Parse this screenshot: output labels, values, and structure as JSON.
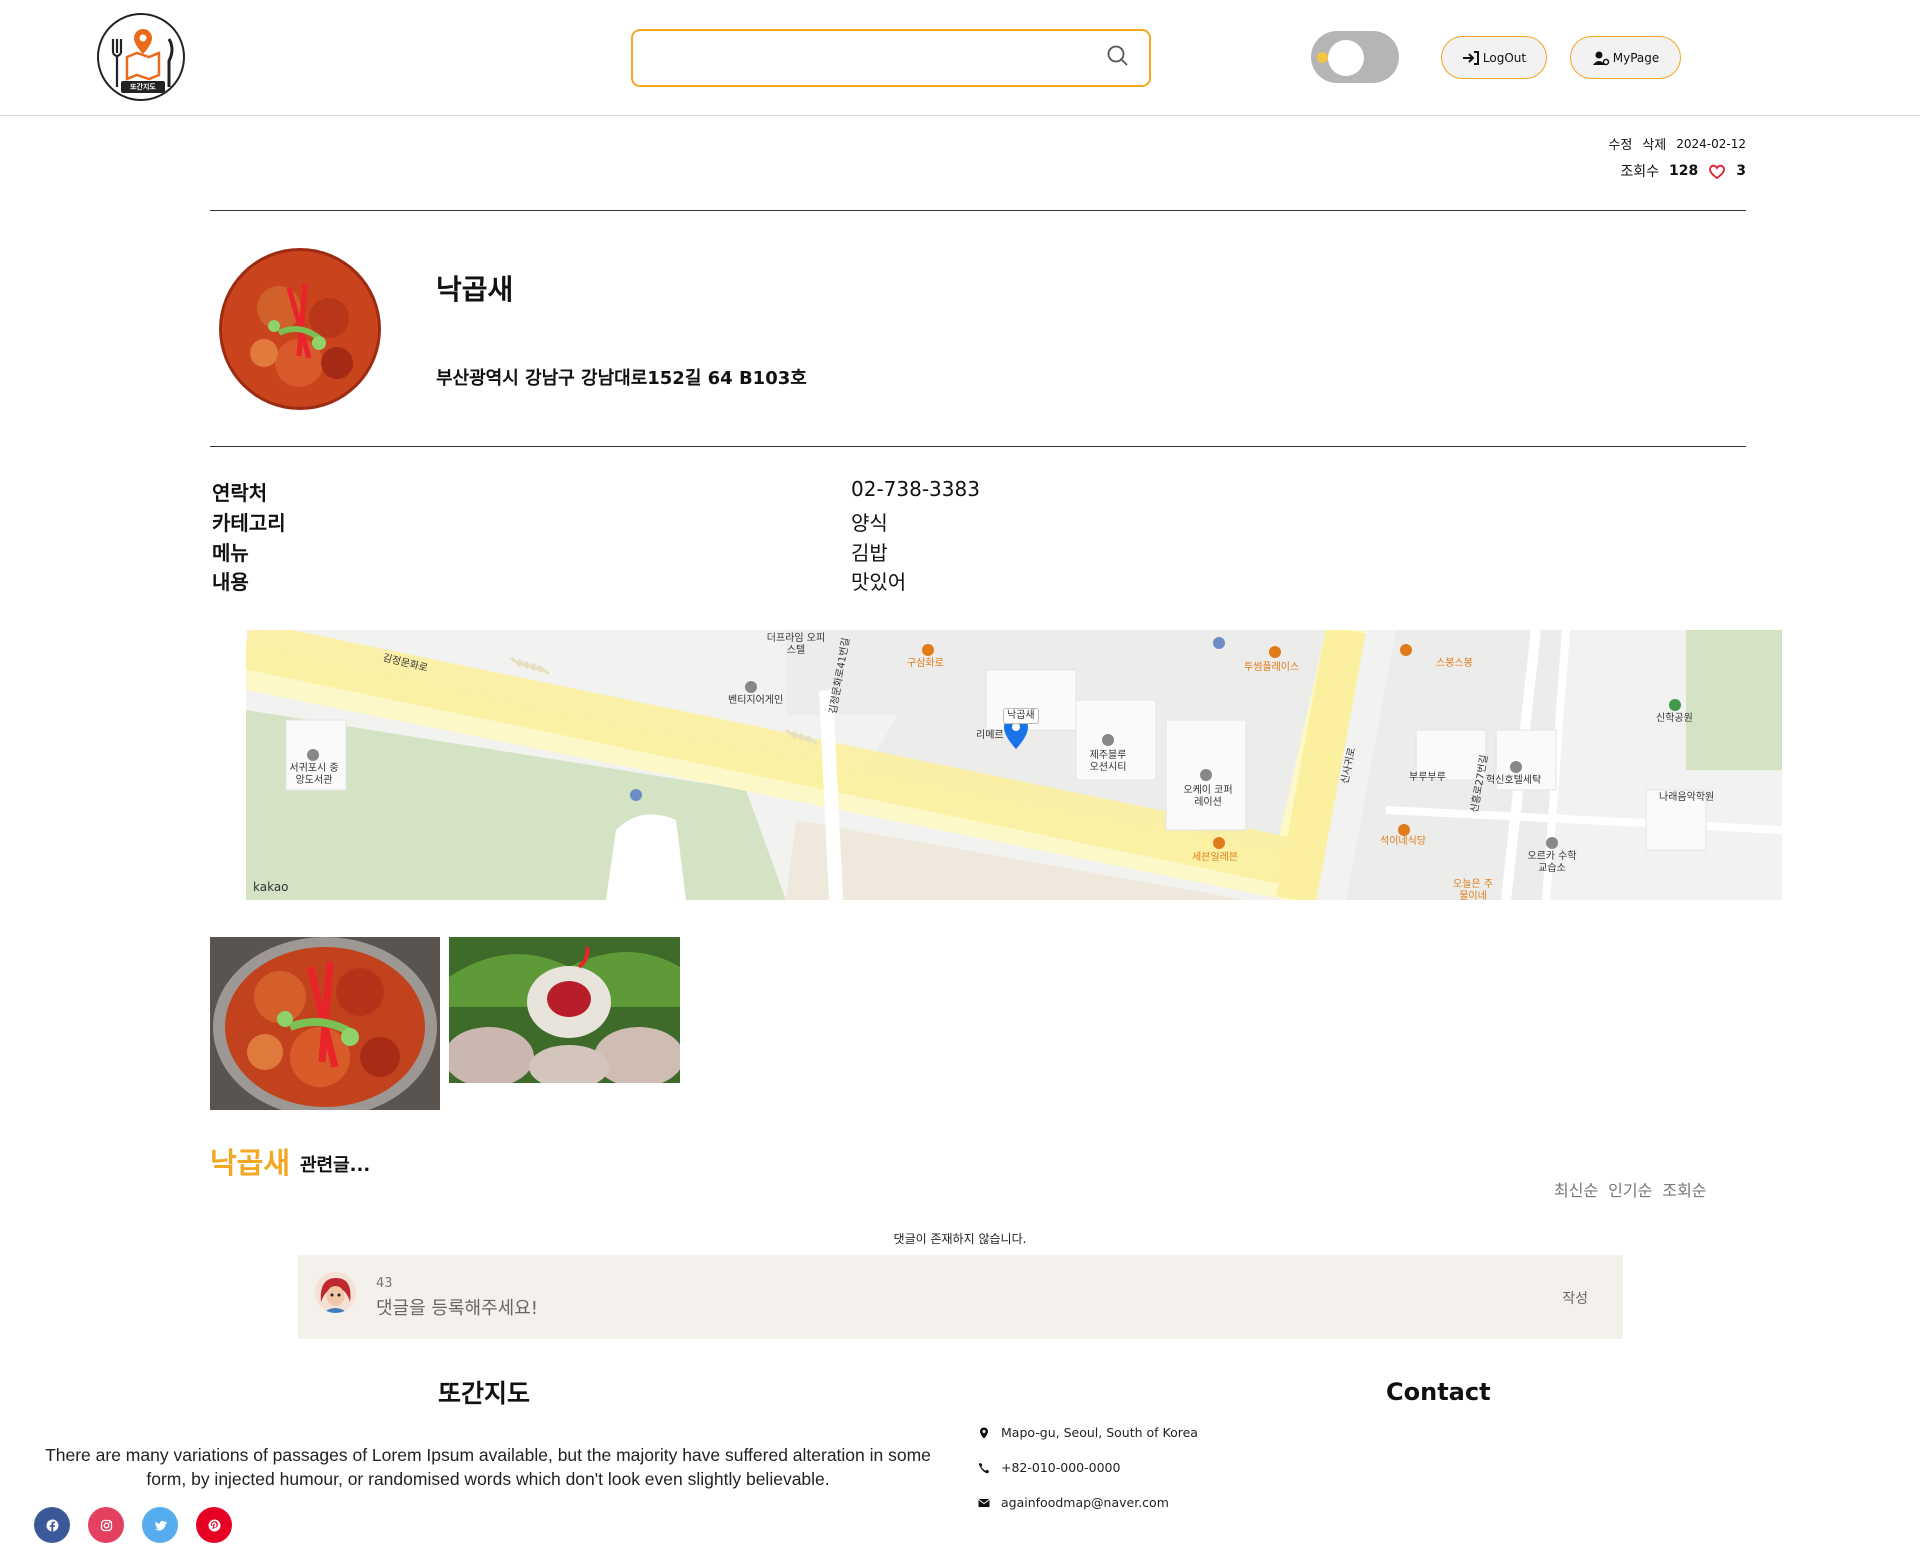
{
  "header": {
    "logo_text": "또간지도",
    "search_placeholder": "",
    "logout_label": "LogOut",
    "mypage_label": "MyPage"
  },
  "post_meta": {
    "edit_label": "수정",
    "delete_label": "삭제",
    "date": "2024-02-12",
    "views_label": "조회수",
    "views": "128",
    "likes": "3"
  },
  "store": {
    "name": "낙곱새",
    "address": "부산광역시 강남구 강남대로152길 64 B103호"
  },
  "info": [
    {
      "label": "연락처",
      "value": "02-738-3383"
    },
    {
      "label": "카테고리",
      "value": "양식"
    },
    {
      "label": "메뉴",
      "value": "김밥"
    },
    {
      "label": "내용",
      "value": "맛있어"
    }
  ],
  "map": {
    "attribution": "kakao",
    "marker_label": "낙곱새",
    "labels": [
      "김정문화로",
      "더프라임 오피스텔",
      "벤티지어게인",
      "구삼화로",
      "리메르",
      "제주블루 오션시티",
      "오케이 코퍼레이션",
      "투썸플레이스",
      "세븐일레븐",
      "스봉스봉",
      "부루부루",
      "혁신호텔세탁",
      "나래음악학원",
      "신학공원",
      "석이네식당",
      "오르카 수학교습소",
      "오늘은 주물이네",
      "서귀포시 중앙도서관",
      "신사귀로",
      "신흥로27번길",
      "김정문화로41번길"
    ]
  },
  "related": {
    "keyword": "낙곱새",
    "suffix": "관련글...",
    "sort_options": [
      "최신순",
      "인기순",
      "조회순"
    ]
  },
  "comments": {
    "empty_message": "댓글이 존재하지 않습니다.",
    "count": "43",
    "placeholder": "댓글을 등록해주세요!",
    "submit_label": "작성"
  },
  "footer": {
    "brand": "또간지도",
    "description": "There are many variations of passages of Lorem Ipsum available, but the majority have suffered alteration in some form, by injected humour, or randomised words which don't look even slightly believable.",
    "contact_title": "Contact",
    "address": "Mapo-gu, Seoul, South of Korea",
    "phone": "+82-010-000-0000",
    "email": "againfoodmap@naver.com",
    "social": [
      {
        "name": "facebook-icon",
        "color": "#3b5998"
      },
      {
        "name": "instagram-icon",
        "color": "#e4405f"
      },
      {
        "name": "twitter-icon",
        "color": "#55acee"
      },
      {
        "name": "pinterest-icon",
        "color": "#e60023"
      }
    ]
  },
  "colors": {
    "accent": "#f5a623",
    "map_marker": "#1a73e8"
  }
}
